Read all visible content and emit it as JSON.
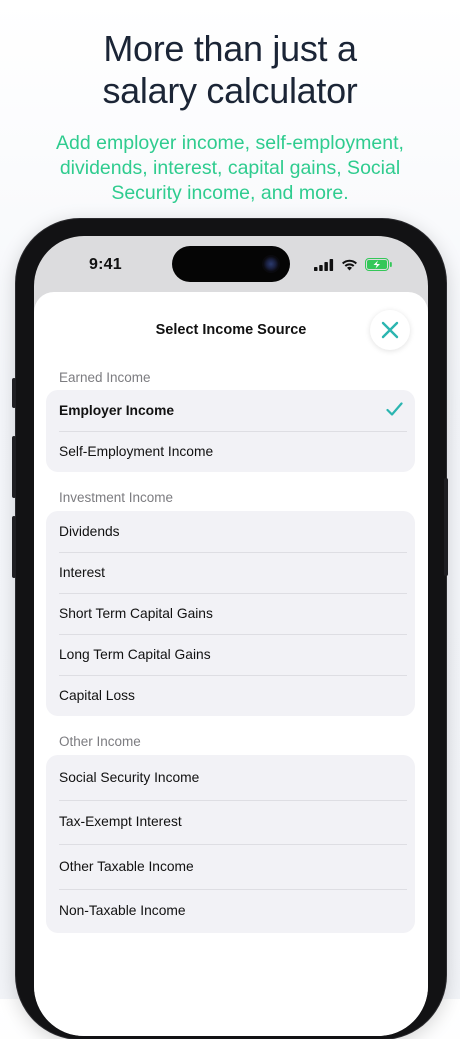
{
  "hero": {
    "headline_line1": "More than just a",
    "headline_line2": "salary calculator",
    "subhead": "Add employer income, self-employment, dividends, interest, capital gains, Social Security income, and more."
  },
  "status_bar": {
    "time": "9:41"
  },
  "sheet": {
    "title": "Select Income Source",
    "sections": [
      {
        "label": "Earned Income",
        "items": [
          {
            "label": "Employer Income",
            "selected": true
          },
          {
            "label": "Self-Employment Income",
            "selected": false
          }
        ]
      },
      {
        "label": "Investment Income",
        "items": [
          {
            "label": "Dividends"
          },
          {
            "label": "Interest"
          },
          {
            "label": "Short Term Capital Gains"
          },
          {
            "label": "Long Term Capital Gains"
          },
          {
            "label": "Capital Loss"
          }
        ]
      },
      {
        "label": "Other Income",
        "items": [
          {
            "label": "Social Security Income"
          },
          {
            "label": "Tax-Exempt Interest"
          },
          {
            "label": "Other Taxable Income"
          },
          {
            "label": "Non-Taxable Income"
          }
        ]
      }
    ]
  },
  "colors": {
    "accent": "#2bb5b0",
    "headline": "#1b2536",
    "subhead": "#2fcc8f"
  },
  "icons": {
    "close": "close-icon",
    "check": "checkmark-icon",
    "signal": "cellular-signal-icon",
    "wifi": "wifi-icon",
    "battery": "battery-charging-icon"
  }
}
